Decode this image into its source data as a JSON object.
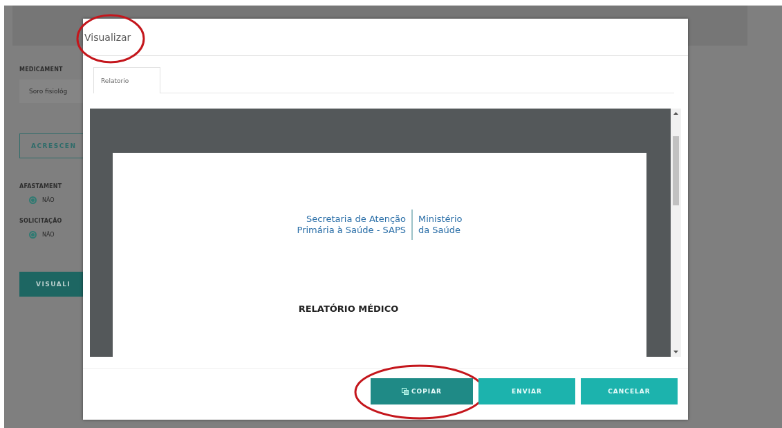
{
  "form": {
    "medication_label": "MEDICAMENT",
    "medication_value": "Soro fisiológ",
    "add_button": "ACRESCEN",
    "groups": [
      {
        "label": "AFASTAMENT",
        "options": [
          {
            "label": "NÃO",
            "selected": true
          }
        ]
      },
      {
        "label": "SOLICITAÇÃO",
        "options": [
          {
            "label": "NÃO",
            "selected": true
          }
        ]
      }
    ],
    "preview_button": "VISUALI"
  },
  "dialog": {
    "title": "Visualizar",
    "title_highlighted": true,
    "tabs": [
      {
        "label": "Relatorio",
        "selected": true
      }
    ],
    "document": {
      "org_line_1": "Secretaria de Atenção",
      "org_line_2": "Primária à Saúde - SAPS",
      "ministry_line_1": "Ministério",
      "ministry_line_2": "da Saúde",
      "heading": "RELATÓRIO MÉDICO"
    },
    "buttons": [
      {
        "label": "COPIAR",
        "kind": "copy",
        "highlighted": true
      },
      {
        "label": "ENVIAR",
        "kind": "plain",
        "highlighted": false
      },
      {
        "label": "CANCELAR",
        "kind": "plain",
        "highlighted": false
      }
    ]
  }
}
